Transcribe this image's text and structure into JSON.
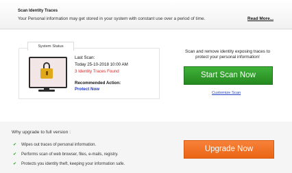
{
  "header": {
    "title": "Scan Identity Traces",
    "subtitle": "Your Personal information may get stored in your system with constant use over a period of time.",
    "read_more": "Read More..."
  },
  "status": {
    "tab_label": "System Status",
    "last_scan_label": "Last Scan:",
    "last_scan_value": "Today 25-10-2018 10:00 AM",
    "traces_found": "3 Identity Traces Found",
    "recommended_label": "Recommended Action:",
    "recommended_value": "Protect Now"
  },
  "cta": {
    "line1": "Scan and remove identity exposing traces to",
    "line2": "protect your personal information!",
    "start_button": "Start Scan Now",
    "customize_link": "Customize Scan"
  },
  "upgrade": {
    "title": "Why upgrade to full version :",
    "features": [
      "Wipes out traces of personal information.",
      "Performs scan of web browser, files, e-mails, registry.",
      "Protects you identity theft, keeping your information safe."
    ],
    "button": "Upgrade Now"
  },
  "colors": {
    "accent_green": "#2f9e29",
    "accent_orange": "#f07326",
    "warning_red": "#d42a2a",
    "link_blue": "#1d36c9"
  },
  "icons": {
    "status": "computer-lock-icon",
    "feature": "check-icon"
  }
}
